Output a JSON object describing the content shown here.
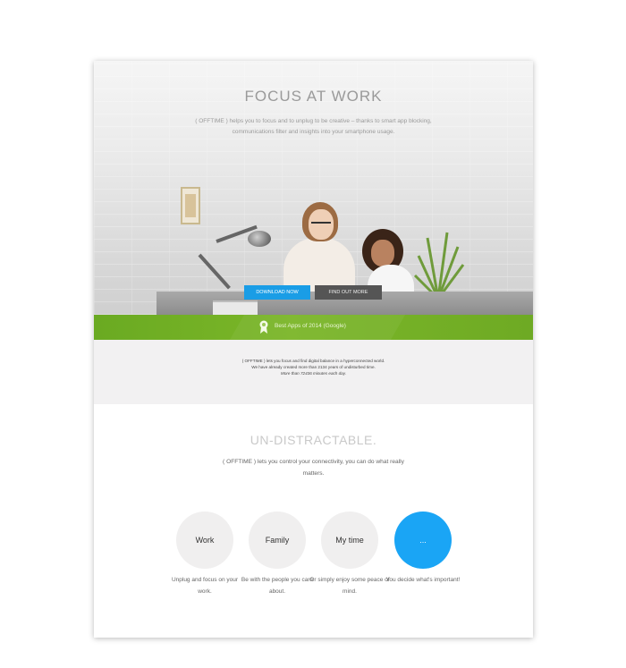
{
  "hero": {
    "title": "FOCUS AT WORK",
    "subtitle": "( OFFTIME ) helps you to focus and to unplug to be creative – thanks to smart app blocking, communications filter and insights into your smartphone usage.",
    "download_label": "DOWNLOAD NOW",
    "find_out_label": "FIND OUT MORE"
  },
  "award": {
    "text": "Best Apps of 2014 (Google)",
    "icon": "award-ribbon-icon"
  },
  "info": {
    "line1": "( OFFTIME ) lets you focus and find digital balance in a hyperconnected world.",
    "line2": "We have already created more than 2134 years of undisturbed time.",
    "line3": "More than 72436 minutes each day."
  },
  "undistractable": {
    "title": "UN-DISTRACTABLE.",
    "subtitle": "( OFFTIME ) lets you control your connectivity, you can do what really matters.",
    "items": [
      {
        "label": "Work",
        "caption": "Unplug and focus on your work."
      },
      {
        "label": "Family",
        "caption": "Be with the people you care about."
      },
      {
        "label": "My time",
        "caption": "Or simply enjoy some peace of mind."
      },
      {
        "label": "...",
        "caption": "You decide what's important!"
      }
    ]
  },
  "colors": {
    "accent_blue": "#1a9de6",
    "green_band": "#76b227",
    "info_bg": "#f2f1f2"
  }
}
